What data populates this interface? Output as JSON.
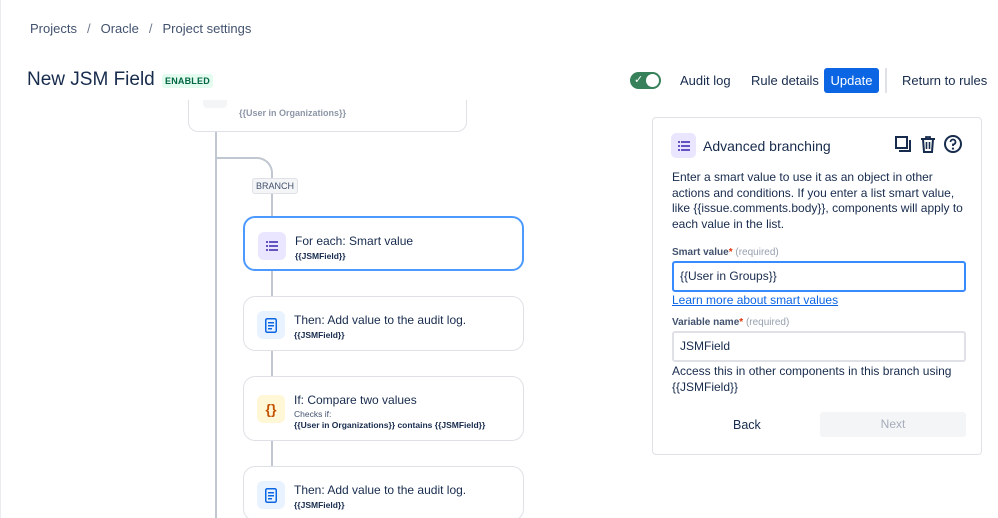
{
  "breadcrumb": {
    "items": [
      "Projects",
      "Oracle",
      "Project settings"
    ],
    "separator": "/"
  },
  "header": {
    "title": "New JSM Field",
    "status_badge": "ENABLED",
    "toggle_on": true,
    "audit_log": "Audit log",
    "rule_details": "Rule details",
    "update": "Update",
    "return_to_rules": "Return to rules"
  },
  "canvas": {
    "top_card_partial": "{{User in Organizations}}",
    "branch_label": "BRANCH",
    "cards": [
      {
        "title": "For each: Smart value",
        "sub": "{{JSMField}}",
        "icon": "list-icon"
      },
      {
        "title": "Then: Add value to the audit log.",
        "sub": "{{JSMField}}",
        "icon": "document-icon"
      },
      {
        "title": "If: Compare two values",
        "checks": "Checks if:",
        "sub": "{{User in Organizations}} contains {{JSMField}}",
        "icon": "braces-icon"
      },
      {
        "title": "Then: Add value to the audit log.",
        "sub": "{{JSMField}}",
        "icon": "document-icon"
      }
    ]
  },
  "panel": {
    "title": "Advanced branching",
    "description": "Enter a smart value to use it as an object in other actions and conditions. If you enter a list smart value, like {{issue.comments.body}}, components will apply to each value in the list.",
    "smart_value_label": "Smart value",
    "smart_value_required": "(required)",
    "smart_value": "{{User in Groups}}",
    "learn_more": "Learn more about smart values",
    "variable_name_label": "Variable name",
    "variable_name_required": "(required)",
    "variable_name": "JSMField",
    "hint": "Access this in other components in this branch using {{JSMField}}",
    "back": "Back",
    "next": "Next",
    "asterisk": "*"
  },
  "colors": {
    "accent": "#0c66e4",
    "toggle": "#36805a",
    "badge_bg": "#e3fcef",
    "badge_text": "#006644",
    "selected_border": "#4c9aff"
  }
}
